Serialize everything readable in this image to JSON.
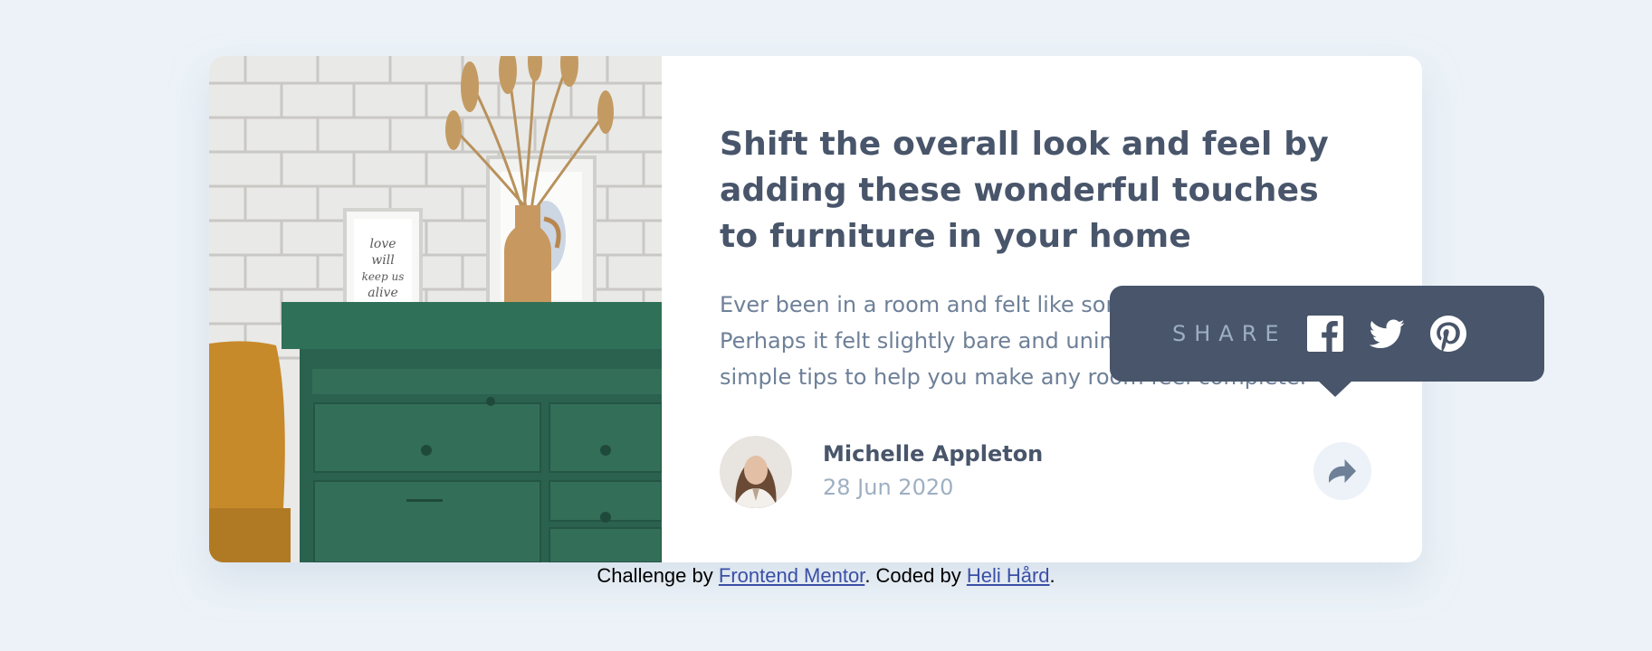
{
  "article": {
    "title": "Shift the overall look and feel by adding these wonderful touches to furniture in your home",
    "description": "Ever been in a room and felt like something was missing? Perhaps it felt slightly bare and uninviting. I've got some simple tips to help you make any room feel complete.",
    "image_alt": "drawers"
  },
  "author": {
    "name": "Michelle Appleton",
    "date": "28 Jun 2020",
    "avatar_icon": "avatar-michelle"
  },
  "share": {
    "label": "SHARE",
    "networks": [
      {
        "name": "Facebook",
        "icon": "facebook-icon"
      },
      {
        "name": "Twitter",
        "icon": "twitter-icon"
      },
      {
        "name": "Pinterest",
        "icon": "pinterest-icon"
      }
    ],
    "button_icon": "share-arrow-icon"
  },
  "footer": {
    "prefix": "Challenge by ",
    "link1": "Frontend Mentor",
    "middle": ". Coded by ",
    "link2": "Heli Hård",
    "suffix": "."
  },
  "colors": {
    "background": "#ecf2f8",
    "title": "#48556a",
    "text": "#6e8098",
    "muted": "#9eafc2",
    "popup": "#48556a",
    "link": "#3a4fa6"
  }
}
